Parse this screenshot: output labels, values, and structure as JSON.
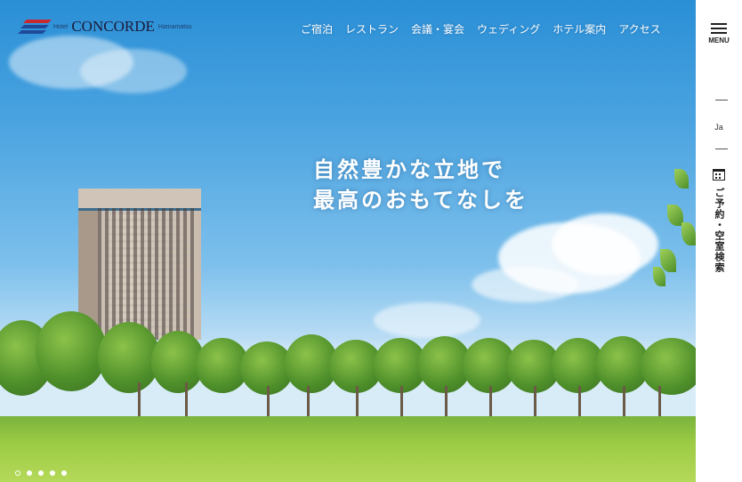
{
  "header": {
    "logo": {
      "small_left": "Hotel",
      "main": "CONCORDE",
      "small_right": "Hamamatsu"
    },
    "nav": [
      "ご宿泊",
      "レストラン",
      "会議・宴会",
      "ウェディング",
      "ホテル案内",
      "アクセス"
    ]
  },
  "hero": {
    "headline_lines": [
      "自然豊かな立地で",
      "最高のおもてなしを"
    ],
    "slides": {
      "count": 5,
      "active_index": 0
    }
  },
  "sidebar": {
    "menu_label": "MENU",
    "lang": "Ja",
    "reserve_label": "ご予約・空室検索"
  },
  "colors": {
    "logo_red": "#c8282e",
    "logo_blue": "#1f4a9a",
    "sky_top": "#2a8fd6",
    "grass": "#9bcb44"
  },
  "icons": [
    "hamburger-icon",
    "calendar-icon"
  ]
}
